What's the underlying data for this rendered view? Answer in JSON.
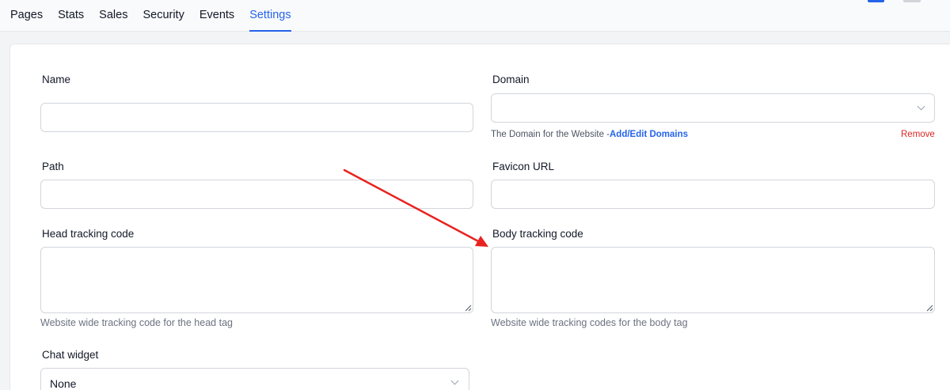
{
  "tabs": [
    {
      "label": "Pages"
    },
    {
      "label": "Stats"
    },
    {
      "label": "Sales"
    },
    {
      "label": "Security"
    },
    {
      "label": "Events"
    },
    {
      "label": "Settings"
    }
  ],
  "active_tab": "Settings",
  "form": {
    "name": {
      "label": "Name",
      "value": ""
    },
    "domain": {
      "label": "Domain",
      "value": "",
      "help_prefix": "The Domain for the Website -",
      "help_link": "Add/Edit Domains",
      "remove_label": "Remove"
    },
    "path": {
      "label": "Path",
      "value": ""
    },
    "favicon": {
      "label": "Favicon URL",
      "value": ""
    },
    "head_tracking": {
      "label": "Head tracking code",
      "value": "",
      "help": "Website wide tracking code for the head tag"
    },
    "body_tracking": {
      "label": "Body tracking code",
      "value": "",
      "help": "Website wide tracking codes for the body tag"
    },
    "chat_widget": {
      "label": "Chat widget",
      "value": "None"
    }
  },
  "colors": {
    "accent": "#2563eb",
    "danger": "#dc2626",
    "annotation_arrow": "#e8231f"
  }
}
